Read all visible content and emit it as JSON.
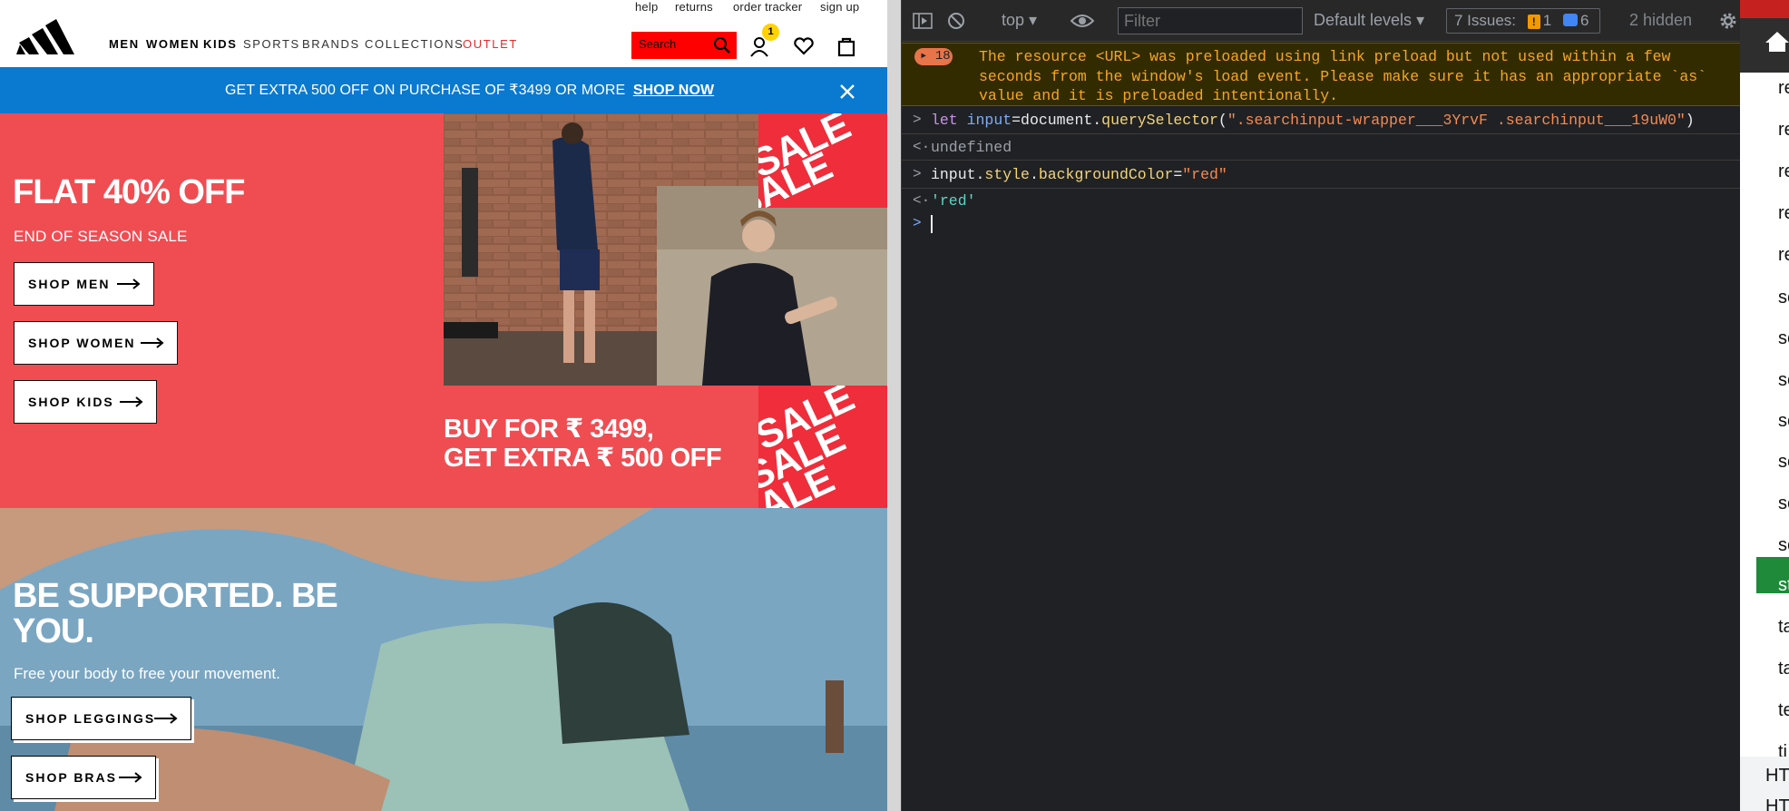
{
  "site": {
    "utility_links": [
      "help",
      "returns",
      "order tracker",
      "sign up"
    ],
    "nav": [
      "MEN",
      "WOMEN",
      "KIDS",
      "SPORTS",
      "BRANDS",
      "COLLECTIONS",
      "OUTLET"
    ],
    "search_placeholder": "Search",
    "cart_badge": "1",
    "promo": {
      "text": "GET EXTRA 500 OFF ON PURCHASE OF ₹3499 OR MORE",
      "link": "SHOP NOW"
    },
    "hero": {
      "title": "FLAT 40% OFF",
      "subtitle": "END OF SEASON SALE",
      "buttons": [
        "SHOP MEN",
        "SHOP WOMEN",
        "SHOP KIDS"
      ],
      "offer_line1": "BUY FOR ₹ 3499,",
      "offer_line2": "GET EXTRA ₹ 500 OFF",
      "sale_word": "SALE"
    },
    "section2": {
      "title": "BE SUPPORTED. BE YOU.",
      "subtitle": "Free your body to free your movement.",
      "buttons": [
        "SHOP LEGGINGS",
        "SHOP BRAS"
      ]
    },
    "colors": {
      "hero_red": "#ef4d52",
      "promo_blue": "#0a79d0",
      "search_red": "#ff0000"
    }
  },
  "devtools": {
    "context": "top",
    "filter_placeholder": "Filter",
    "levels": "Default levels",
    "issues_label": "7 Issues:",
    "issues_warn": "1",
    "issues_info": "6",
    "hidden": "2 hidden",
    "warning": {
      "count": "18",
      "message": "The resource <URL> was preloaded using link preload but not used within a few\nseconds from the window's load event. Please make sure it has an appropriate `as`\nvalue and it is preloaded intentionally."
    },
    "console": [
      {
        "type": "input",
        "parts": [
          "let",
          " ",
          "input",
          "=document.",
          "querySelector",
          "(",
          "\".searchinput-wrapper___3YrvF .searchinput___19uW0\"",
          ")"
        ]
      },
      {
        "type": "output",
        "text": "undefined"
      },
      {
        "type": "input",
        "parts": [
          "input.",
          "style",
          ".",
          "backgroundColor",
          "=",
          "\"red\""
        ]
      },
      {
        "type": "output",
        "text": "'red'"
      }
    ]
  },
  "side_panel": {
    "rows": [
      "re",
      "re",
      "re",
      "re",
      "re",
      "sc",
      "sc",
      "sc",
      "sc",
      "sc",
      "sc",
      "sc",
      "st",
      "ta",
      "ta",
      "te",
      "ti"
    ],
    "footer": [
      "HT",
      "HT"
    ]
  }
}
